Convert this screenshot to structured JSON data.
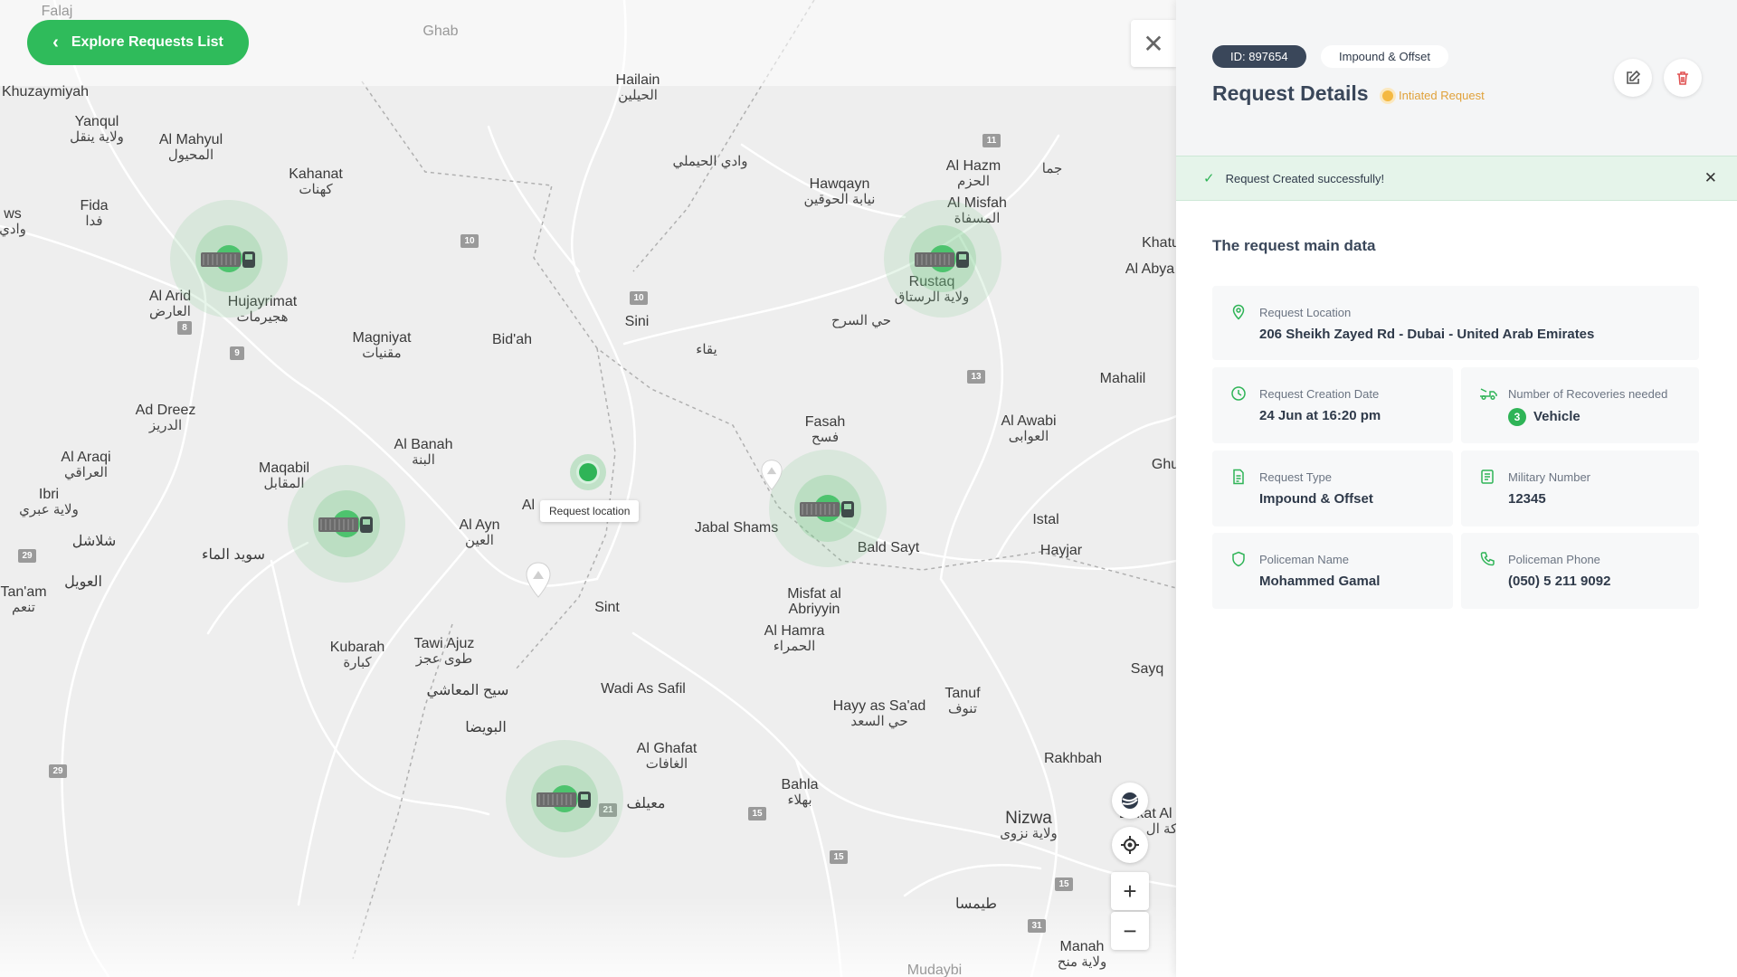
{
  "map": {
    "explore_button": "Explore Requests List",
    "request_location_label": "Request location",
    "zoom_in": "+",
    "zoom_out": "−",
    "close": "✕",
    "places": [
      {
        "en": "Falaj",
        "ar": ""
      },
      {
        "en": "Ghab",
        "ar": ""
      },
      {
        "en": "Hailain",
        "ar": "الحيلين"
      },
      {
        "en": "Khuzaymiyah",
        "ar": ""
      },
      {
        "en": "Yanqul",
        "ar": "ولاية ينقل"
      },
      {
        "en": "Al Mahyul",
        "ar": "المحيول"
      },
      {
        "en": "Kahanat",
        "ar": "كهنات"
      },
      {
        "en": "Fida",
        "ar": "فدا"
      },
      {
        "en": "ws",
        "ar": "وادي"
      },
      {
        "en": "",
        "ar": "وادي الحيملي"
      },
      {
        "en": "Hawqayn",
        "ar": "نيابة الحوقين"
      },
      {
        "en": "Al Hazm",
        "ar": "الحزم"
      },
      {
        "en": "Al Misfah",
        "ar": "المسفاة"
      },
      {
        "en": "",
        "ar": "جما"
      },
      {
        "en": "Khatu",
        "ar": ""
      },
      {
        "en": "Al Abya",
        "ar": ""
      },
      {
        "en": "Al Arid",
        "ar": "العارض"
      },
      {
        "en": "Hujayrimat",
        "ar": "هجيرمات"
      },
      {
        "en": "Rustaq",
        "ar": "ولاية الرستاق"
      },
      {
        "en": "Magniyat",
        "ar": "مقنيات"
      },
      {
        "en": "Bid'ah",
        "ar": ""
      },
      {
        "en": "Sini",
        "ar": ""
      },
      {
        "en": "",
        "ar": "حي السرح"
      },
      {
        "en": "",
        "ar": "يقاء"
      },
      {
        "en": "Mahalil",
        "ar": ""
      },
      {
        "en": "Ad Dreez",
        "ar": "الدريز"
      },
      {
        "en": "Fasah",
        "ar": "فسح"
      },
      {
        "en": "Al Awabi",
        "ar": "العوابى"
      },
      {
        "en": "Al Araqi",
        "ar": "العراقي"
      },
      {
        "en": "Maqabil",
        "ar": "المقابل"
      },
      {
        "en": "Al Banah",
        "ar": "البنة"
      },
      {
        "en": "Ibri",
        "ar": "ولاية عبري"
      },
      {
        "en": "Ghu",
        "ar": ""
      },
      {
        "en": "Al",
        "ar": ""
      },
      {
        "en": "Al Ayn",
        "ar": "العين"
      },
      {
        "en": "Jabal Shams",
        "ar": ""
      },
      {
        "en": "Istal",
        "ar": ""
      },
      {
        "en": "",
        "ar": "شلاشل"
      },
      {
        "en": "",
        "ar": "سويد الماء"
      },
      {
        "en": "Bald Sayt",
        "ar": ""
      },
      {
        "en": "Hayjar",
        "ar": ""
      },
      {
        "en": "Tan'am",
        "ar": "تنعم"
      },
      {
        "en": "",
        "ar": "العويل"
      },
      {
        "en": "Sint",
        "ar": ""
      },
      {
        "en": "Misfat al Abriyyin",
        "ar": ""
      },
      {
        "en": "Al Hamra",
        "ar": "الحمراء"
      },
      {
        "en": "Kubarah",
        "ar": "كبارة"
      },
      {
        "en": "Tawi Ajuz",
        "ar": "طوى عجز"
      },
      {
        "en": "Sayq",
        "ar": ""
      },
      {
        "en": "",
        "ar": "سيح المعاشي"
      },
      {
        "en": "Wadi As Safil",
        "ar": ""
      },
      {
        "en": "Tanuf",
        "ar": "تنوف"
      },
      {
        "en": "Hayy as Sa'ad",
        "ar": "حي السعد"
      },
      {
        "en": "",
        "ar": "البويضا"
      },
      {
        "en": "Al Ghafat",
        "ar": "الغافات"
      },
      {
        "en": "Rakhbah",
        "ar": ""
      },
      {
        "en": "Bahla",
        "ar": "بهلاء"
      },
      {
        "en": "",
        "ar": "معيلف"
      },
      {
        "en": "Nizwa",
        "ar": "ولاية نزوى"
      },
      {
        "en": "Birkat Al Mou",
        "ar": "كة ال"
      },
      {
        "en": "",
        "ar": "طيمسا"
      },
      {
        "en": "Manah",
        "ar": "ولاية منح"
      },
      {
        "en": "Mudaybi",
        "ar": ""
      }
    ],
    "road_shields": [
      "11",
      "10",
      "10",
      "8",
      "9",
      "13",
      "29",
      "29",
      "21",
      "15",
      "15",
      "15",
      "31"
    ]
  },
  "panel": {
    "id_badge": "ID: 897654",
    "type_badge": "Impound & Offset",
    "title": "Request Details",
    "status": "Intiated Request",
    "status_color": "#f4b942",
    "alert_text": "Request Created successfully!",
    "section_title": "The request main data",
    "location": {
      "label": "Request Location",
      "value": "206 Sheikh Zayed Rd - Dubai - United Arab Emirates"
    },
    "creation_date": {
      "label": "Request Creation Date",
      "value": "24 Jun at 16:20 pm"
    },
    "recoveries": {
      "label": "Number of Recoveries needed",
      "count": "3",
      "unit": "Vehicle"
    },
    "request_type": {
      "label": "Request Type",
      "value": "Impound & Offset"
    },
    "military_number": {
      "label": "Military Number",
      "value": "12345"
    },
    "policeman_name": {
      "label": "Policeman Name",
      "value": "Mohammed Gamal"
    },
    "policeman_phone": {
      "label": "Policeman Phone",
      "value": "(050) 5 211 9092"
    },
    "accent_color": "#2fb457"
  }
}
